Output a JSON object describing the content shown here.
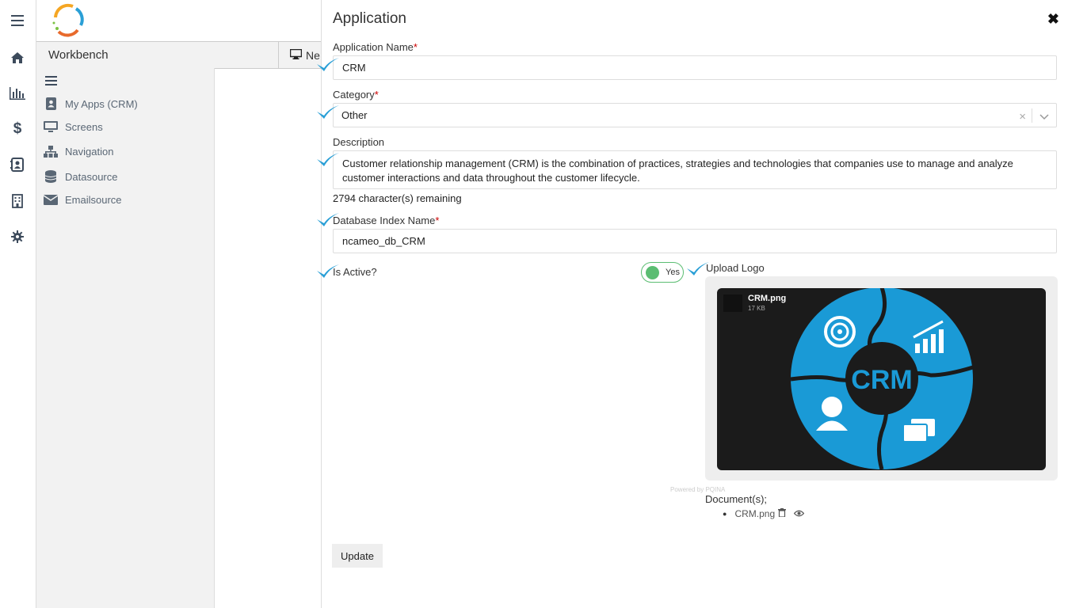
{
  "workbench": {
    "title": "Workbench",
    "new_label": "Ne"
  },
  "sidebar": {
    "items": [
      {
        "label": "My Apps (CRM)",
        "icon": "contacts-icon"
      },
      {
        "label": "Screens",
        "icon": "monitor-icon"
      },
      {
        "label": "Navigation",
        "icon": "sitemap-icon"
      },
      {
        "label": "Datasource",
        "icon": "database-icon"
      },
      {
        "label": "Emailsource",
        "icon": "envelope-icon"
      }
    ]
  },
  "rail": {
    "icons": [
      "menu-icon",
      "home-icon",
      "bar-chart-icon",
      "dollar-icon",
      "contacts-icon",
      "building-icon",
      "gear-icon"
    ]
  },
  "modal": {
    "title": "Application",
    "close_label": "✖",
    "app_name": {
      "label": "Application Name",
      "required": "*",
      "value": "CRM"
    },
    "category": {
      "label": "Category",
      "required": "*",
      "value": "Other",
      "clear": "×"
    },
    "description": {
      "label": "Description",
      "value": "Customer relationship management (CRM) is the combination of practices, strategies and technologies that companies use to manage and analyze customer interactions and data throughout the customer lifecycle.",
      "remaining": "2794 character(s) remaining"
    },
    "db_index": {
      "label": "Database Index Name",
      "required": "*",
      "value": "ncameo_db_CRM"
    },
    "is_active": {
      "label": "Is Active?",
      "toggle_label": "Yes"
    },
    "upload": {
      "label": "Upload Logo",
      "file_name": "CRM.png",
      "file_size": "17 KB",
      "powered_by": "Powered by PQINA",
      "logo_text": "CRM"
    },
    "documents": {
      "label": "Document(s);",
      "items": [
        {
          "name": "CRM.png"
        }
      ]
    },
    "update_label": "Update"
  },
  "colors": {
    "accent_check": "#2a9fd6",
    "toggle_on": "#5bbd72",
    "crm_blue": "#1a9ad6"
  }
}
